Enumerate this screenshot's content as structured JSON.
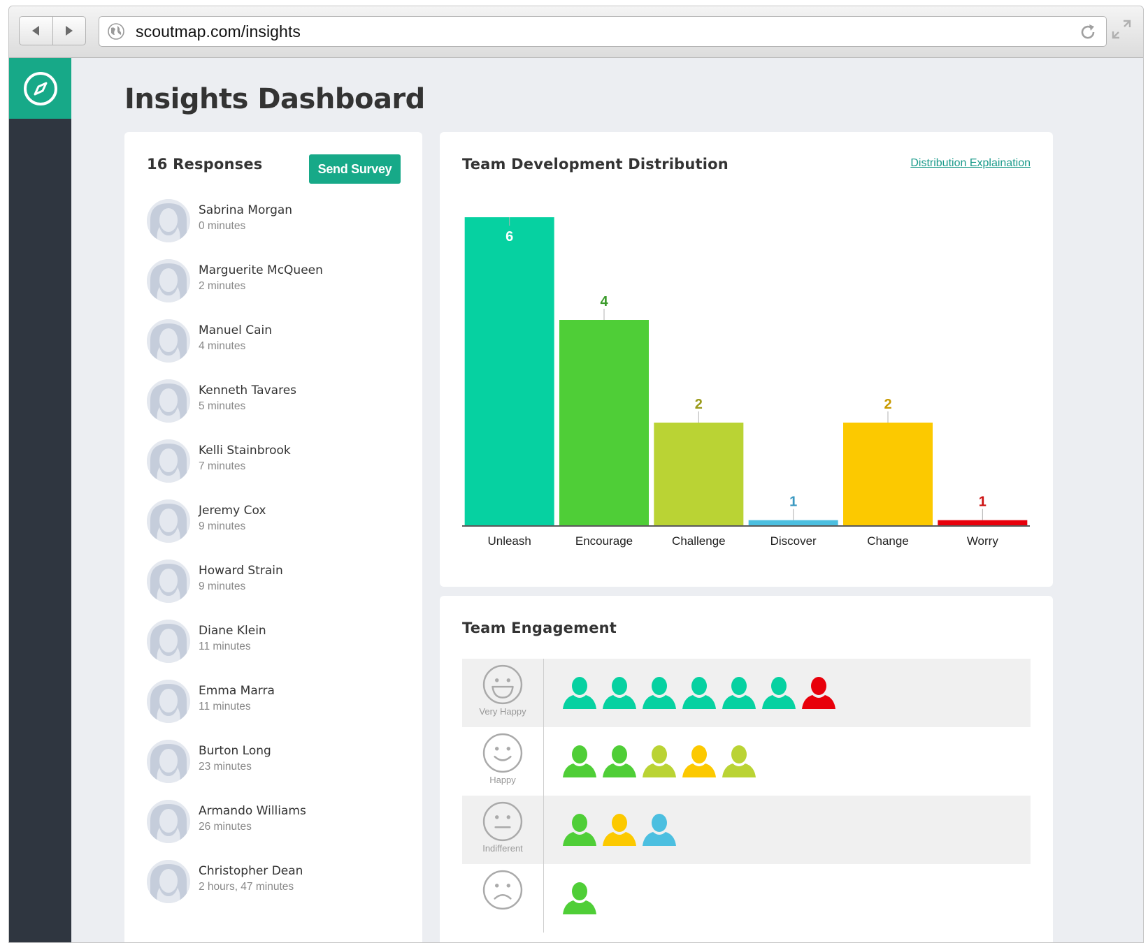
{
  "browser": {
    "url": "scoutmap.com/insights"
  },
  "page": {
    "title": "Insights Dashboard"
  },
  "responses": {
    "count_label": "16 Responses",
    "send_label": "Send Survey",
    "items": [
      {
        "name": "Sabrina Morgan",
        "time": "0 minutes"
      },
      {
        "name": "Marguerite McQueen",
        "time": "2 minutes"
      },
      {
        "name": "Manuel Cain",
        "time": "4 minutes"
      },
      {
        "name": "Kenneth Tavares",
        "time": "5 minutes"
      },
      {
        "name": "Kelli Stainbrook",
        "time": "7 minutes"
      },
      {
        "name": "Jeremy Cox",
        "time": "9 minutes"
      },
      {
        "name": "Howard Strain",
        "time": "9 minutes"
      },
      {
        "name": "Diane Klein",
        "time": "11 minutes"
      },
      {
        "name": "Emma Marra",
        "time": "11 minutes"
      },
      {
        "name": "Burton Long",
        "time": "23 minutes"
      },
      {
        "name": "Armando Williams",
        "time": "26 minutes"
      },
      {
        "name": "Christopher Dean",
        "time": "2 hours, 47 minutes"
      }
    ]
  },
  "distribution": {
    "title": "Team Development Distribution",
    "link_label": "Distribution Explaination"
  },
  "chart_data": {
    "type": "bar",
    "title": "Team Development Distribution",
    "categories": [
      "Unleash",
      "Encourage",
      "Challenge",
      "Discover",
      "Change",
      "Worry"
    ],
    "values": [
      6,
      4,
      2,
      0.1,
      2,
      0.1
    ],
    "labels": [
      "6",
      "4",
      "2",
      "1",
      "2",
      "1"
    ],
    "colors": [
      "#06d1a1",
      "#4fce37",
      "#bad334",
      "#4cbfe0",
      "#fcc900",
      "#e8000b"
    ],
    "label_colors": [
      "#ffffff",
      "#3a9a2a",
      "#9a9a1a",
      "#3a98c0",
      "#c89a00",
      "#cc1111"
    ],
    "ylim": [
      0,
      6
    ],
    "grid": false,
    "legend": "none"
  },
  "engagement": {
    "title": "Team Engagement",
    "colors": {
      "unleash": "#06d1a1",
      "encourage": "#4fce37",
      "challenge": "#bad334",
      "change": "#fcc900",
      "discover": "#4cbfe0",
      "worry": "#e8000b"
    },
    "rows": [
      {
        "mood": "Very Happy",
        "face": "very-happy-face-icon",
        "people": [
          "unleash",
          "unleash",
          "unleash",
          "unleash",
          "unleash",
          "unleash",
          "worry"
        ]
      },
      {
        "mood": "Happy",
        "face": "happy-face-icon",
        "people": [
          "encourage",
          "encourage",
          "challenge",
          "change",
          "challenge"
        ]
      },
      {
        "mood": "Indifferent",
        "face": "indifferent-face-icon",
        "people": [
          "encourage",
          "change",
          "discover"
        ]
      },
      {
        "mood": "",
        "face": "sad-face-icon",
        "people": [
          "encourage"
        ]
      }
    ]
  }
}
